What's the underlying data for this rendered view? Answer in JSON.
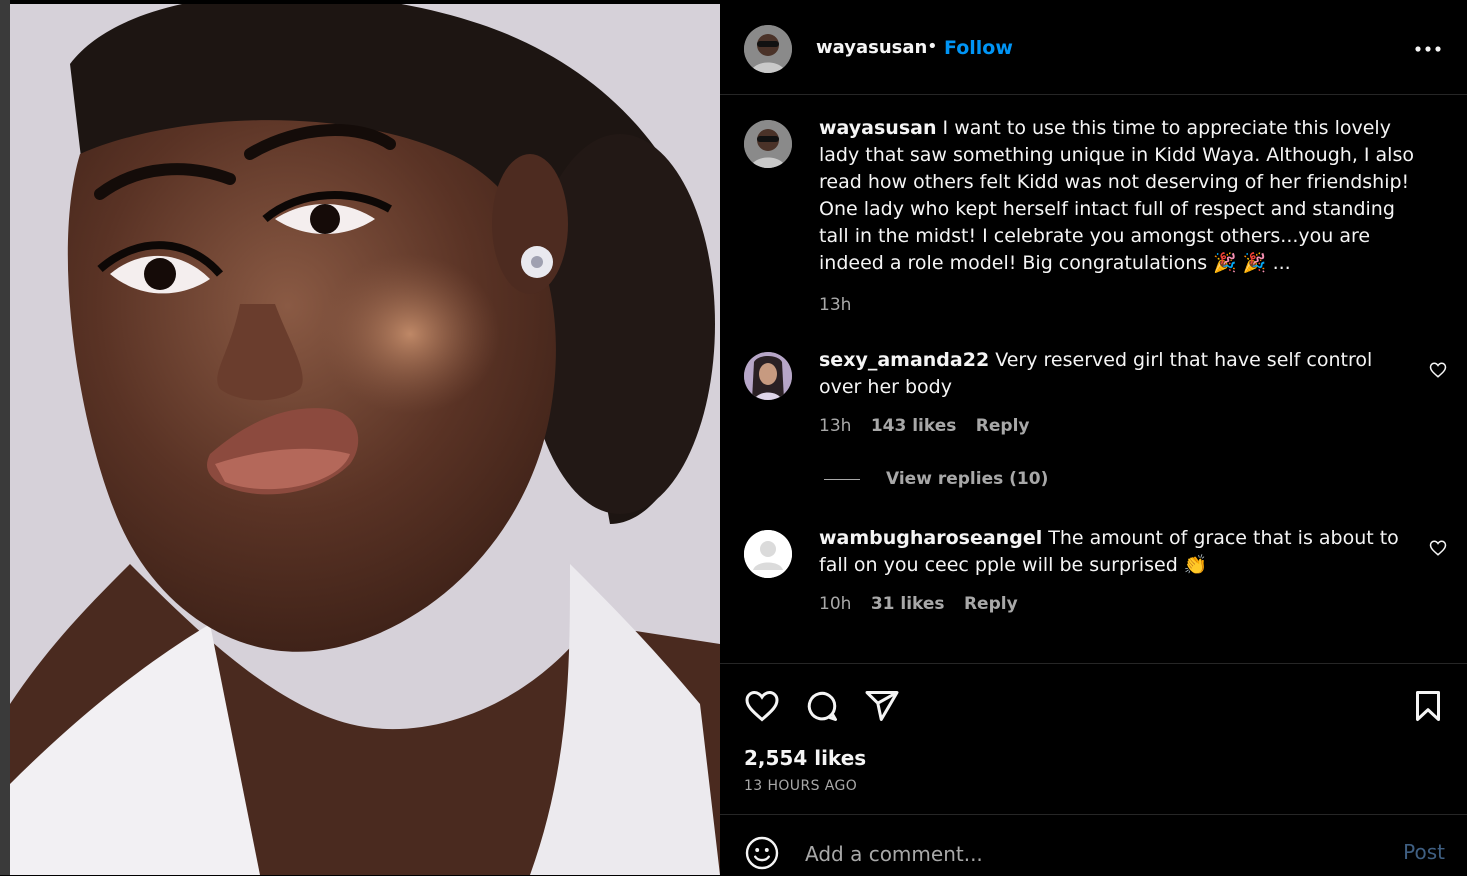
{
  "post": {
    "username": "wayasusan",
    "follow_label": "Follow",
    "separator": "•",
    "more_label": "•••"
  },
  "caption": {
    "username": "wayasusan",
    "text": "I want to use this time to appreciate this lovely lady that saw something unique in Kidd Waya. Although, I also read how others felt Kidd was not deserving of her friendship! One lady who kept herself intact full of respect and standing tall in the midst! I celebrate you amongst others...you are indeed a role model! Big congratulations 🎉 🎉 ...",
    "time": "13h"
  },
  "comments": [
    {
      "username": "sexy_amanda22",
      "text": "Very reserved girl that have self control over her body",
      "time": "13h",
      "likes": "143 likes",
      "reply_label": "Reply",
      "view_replies": "View replies (10)"
    },
    {
      "username": "wambugharoseangel",
      "text": "The amount of grace that is about to fall on you ceec pple will be surprised 👏",
      "time": "10h",
      "likes": "31 likes",
      "reply_label": "Reply"
    }
  ],
  "actions": {
    "likes": "2,554 likes",
    "time_ago": "13 HOURS AGO"
  },
  "add_comment": {
    "placeholder": "Add a comment...",
    "post_label": "Post"
  },
  "icons": {
    "like": "heart-icon",
    "comment": "comment-bubble-icon",
    "share": "paper-plane-icon",
    "save": "bookmark-icon",
    "emoji": "smiley-icon",
    "more": "more-dots-icon"
  },
  "colors": {
    "accent": "#0095f6",
    "background": "#000000",
    "muted_text": "#a8a8a8"
  }
}
